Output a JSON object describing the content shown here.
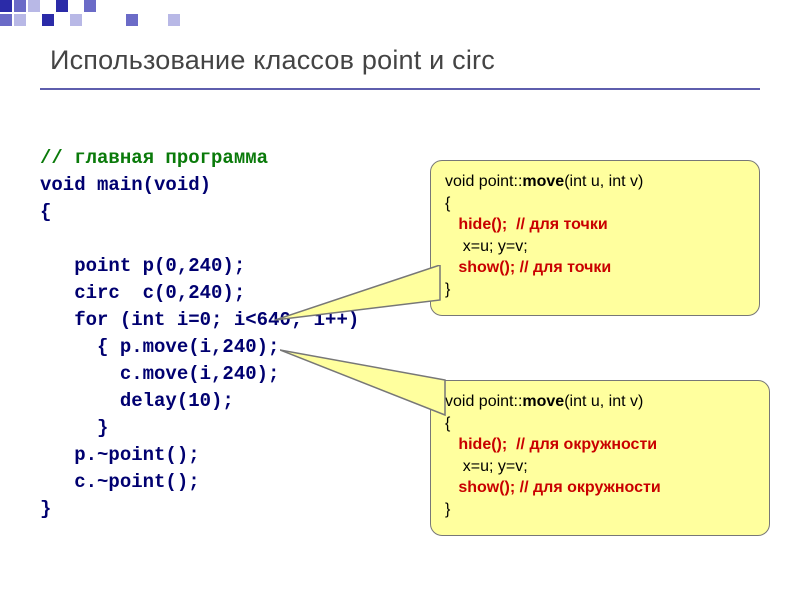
{
  "title": "Использование классов point и circ",
  "colors": {
    "deco1": "#2b2ba8",
    "deco2": "#6b6bc7",
    "deco3": "#b8b8e6",
    "code": "#000070",
    "comment": "#0a7a0a",
    "callout_bg": "#ffff9e",
    "callout_border": "#777",
    "red": "#c90000"
  },
  "code": {
    "l1": "// главная программа",
    "l2": "void main(void)",
    "l3": "{",
    "l4": "",
    "l5": "   point p(0,240);",
    "l6": "   circ  c(0,240);",
    "l7": "   for (int i=0; i<640; i++)",
    "l8": "     { p.move(i,240);",
    "l9": "       c.move(i,240);",
    "l10": "       delay(10);",
    "l11": "     }",
    "l12": "   p.~point();",
    "l13": "   c.~point();",
    "l14": "}"
  },
  "callout1": {
    "sig_pre": "void point::",
    "sig_bold": "move",
    "sig_post": "(int u, int v)",
    "open": "{",
    "hide": "   hide();  // для точки",
    "assign": "    x=u; y=v;",
    "show": "   show(); // для точки",
    "close": "}"
  },
  "callout2": {
    "sig_pre": "void point::",
    "sig_bold": "move",
    "sig_post": "(int u, int v)",
    "open": "{",
    "hide": "   hide();  // для окружности",
    "assign": "    x=u; y=v;",
    "show": "   show(); // для окружности",
    "close": "}"
  }
}
